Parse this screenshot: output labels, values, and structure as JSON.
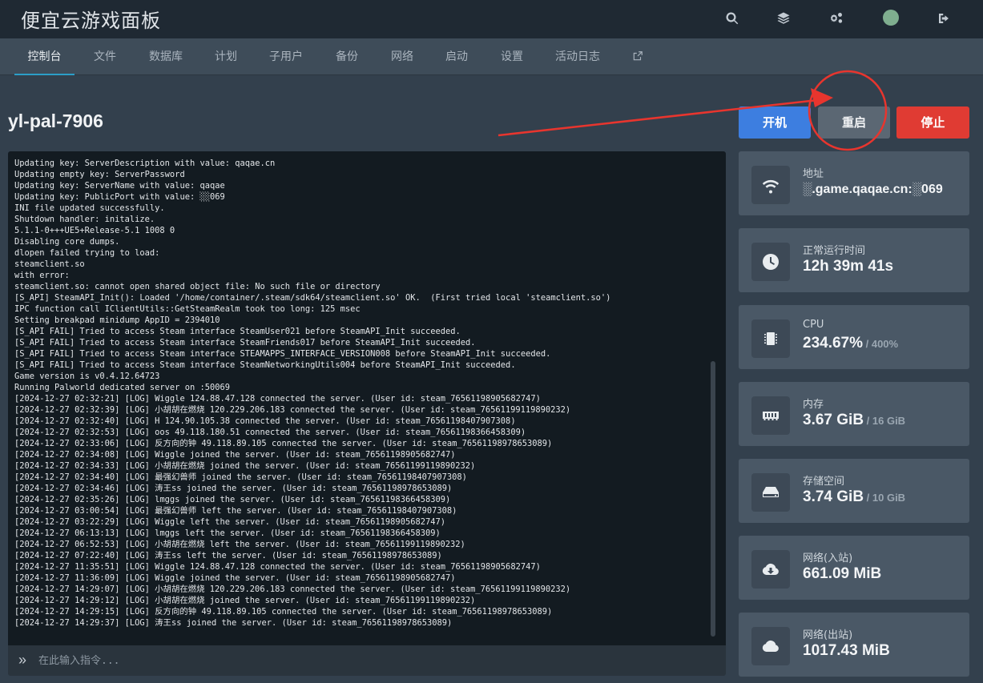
{
  "app": {
    "title": "便宜云游戏面板"
  },
  "topbar": {
    "icons": [
      "search-icon",
      "layers-icon",
      "cogs-icon",
      "avatar",
      "logout-icon"
    ]
  },
  "tabs": [
    {
      "label": "控制台",
      "active": true
    },
    {
      "label": "文件"
    },
    {
      "label": "数据库"
    },
    {
      "label": "计划"
    },
    {
      "label": "子用户"
    },
    {
      "label": "备份"
    },
    {
      "label": "网络"
    },
    {
      "label": "启动"
    },
    {
      "label": "设置"
    },
    {
      "label": "活动日志"
    }
  ],
  "server": {
    "name": "yl-pal-7906"
  },
  "power": {
    "start_label": "开机",
    "restart_label": "重启",
    "stop_label": "停止"
  },
  "console": {
    "lines": [
      "Updating key: ServerDescription with value: qaqae.cn",
      "Updating empty key: ServerPassword",
      "Updating key: ServerName with value: qaqae",
      "Updating key: PublicPort with value: ░░069",
      "INI file updated successfully.",
      "Shutdown handler: initalize.",
      "5.1.1-0+++UE5+Release-5.1 1008 0",
      "Disabling core dumps.",
      "dlopen failed trying to load:",
      "steamclient.so",
      "with error:",
      "steamclient.so: cannot open shared object file: No such file or directory",
      "[S_API] SteamAPI_Init(): Loaded '/home/container/.steam/sdk64/steamclient.so' OK.  (First tried local 'steamclient.so')",
      "IPC function call IClientUtils::GetSteamRealm took too long: 125 msec",
      "Setting breakpad minidump AppID = 2394010",
      "[S_API FAIL] Tried to access Steam interface SteamUser021 before SteamAPI_Init succeeded.",
      "[S_API FAIL] Tried to access Steam interface SteamFriends017 before SteamAPI_Init succeeded.",
      "[S_API FAIL] Tried to access Steam interface STEAMAPPS_INTERFACE_VERSION008 before SteamAPI_Init succeeded.",
      "[S_API FAIL] Tried to access Steam interface SteamNetworkingUtils004 before SteamAPI_Init succeeded.",
      "Game version is v0.4.12.64723",
      "Running Palworld dedicated server on :50069",
      "[2024-12-27 02:32:21] [LOG] Wiggle 124.88.47.128 connected the server. (User id: steam_76561198905682747)",
      "[2024-12-27 02:32:39] [LOG] 小胡胡在燃烧 120.229.206.183 connected the server. (User id: steam_76561199119890232)",
      "[2024-12-27 02:32:40] [LOG] H 124.90.105.38 connected the server. (User id: steam_76561198407907308)",
      "[2024-12-27 02:32:53] [LOG] oos 49.118.180.51 connected the server. (User id: steam_76561198366458309)",
      "[2024-12-27 02:33:06] [LOG] 反方向的钟 49.118.89.105 connected the server. (User id: steam_76561198978653089)",
      "[2024-12-27 02:34:08] [LOG] Wiggle joined the server. (User id: steam_76561198905682747)",
      "[2024-12-27 02:34:33] [LOG] 小胡胡在燃烧 joined the server. (User id: steam_76561199119890232)",
      "[2024-12-27 02:34:40] [LOG] 最强幻兽师 joined the server. (User id: steam_76561198407907308)",
      "[2024-12-27 02:34:46] [LOG] 涛王ss joined the server. (User id: steam_76561198978653089)",
      "[2024-12-27 02:35:26] [LOG] lmggs joined the server. (User id: steam_76561198366458309)",
      "[2024-12-27 03:00:54] [LOG] 最强幻兽师 left the server. (User id: steam_76561198407907308)",
      "[2024-12-27 03:22:29] [LOG] Wiggle left the server. (User id: steam_76561198905682747)",
      "[2024-12-27 06:13:13] [LOG] lmggs left the server. (User id: steam_76561198366458309)",
      "[2024-12-27 06:52:53] [LOG] 小胡胡在燃烧 left the server. (User id: steam_76561199119890232)",
      "[2024-12-27 07:22:40] [LOG] 涛王ss left the server. (User id: steam_76561198978653089)",
      "[2024-12-27 11:35:51] [LOG] Wiggle 124.88.47.128 connected the server. (User id: steam_76561198905682747)",
      "[2024-12-27 11:36:09] [LOG] Wiggle joined the server. (User id: steam_76561198905682747)",
      "[2024-12-27 14:29:07] [LOG] 小胡胡在燃烧 120.229.206.183 connected the server. (User id: steam_76561199119890232)",
      "[2024-12-27 14:29:12] [LOG] 小胡胡在燃烧 joined the server. (User id: steam_76561199119890232)",
      "[2024-12-27 14:29:15] [LOG] 反方向的钟 49.118.89.105 connected the server. (User id: steam_76561198978653089)",
      "[2024-12-27 14:29:37] [LOG] 涛王ss joined the server. (User id: steam_76561198978653089)"
    ],
    "command_placeholder": "在此输入指令..."
  },
  "stats": [
    {
      "icon": "wifi-icon",
      "label": "地址",
      "value": "░.game.qaqae.cn:░069",
      "sub": ""
    },
    {
      "icon": "clock-icon",
      "label": "正常运行时间",
      "value": "12h 39m 41s",
      "sub": ""
    },
    {
      "icon": "cpu-icon",
      "label": "CPU",
      "value": "234.67%",
      "sub": " / 400%"
    },
    {
      "icon": "memory-icon",
      "label": "内存",
      "value": "3.67 GiB",
      "sub": " / 16 GiB"
    },
    {
      "icon": "hdd-icon",
      "label": "存储空间",
      "value": "3.74 GiB",
      "sub": " / 10 GiB"
    },
    {
      "icon": "cloud-download-icon",
      "label": "网络(入站)",
      "value": "661.09 MiB",
      "sub": ""
    },
    {
      "icon": "cloud-upload-icon",
      "label": "网络(出站)",
      "value": "1017.43 MiB",
      "sub": ""
    }
  ],
  "colors": {
    "accent": "#2b9ec7",
    "start": "#3d7ee0",
    "stop": "#e03b33",
    "annotation": "#e8352e"
  }
}
